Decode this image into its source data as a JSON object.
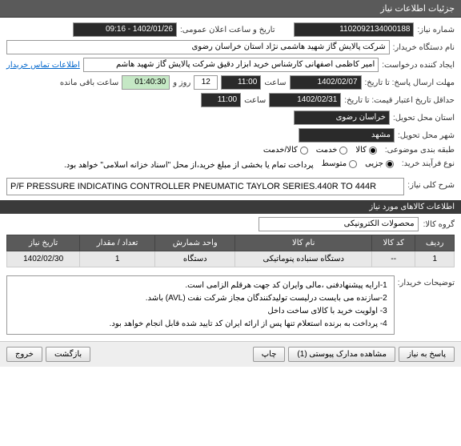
{
  "header": {
    "title": "جزئیات اطلاعات نیاز"
  },
  "fields": {
    "need_number_label": "شماره نیاز:",
    "need_number": "1102092134000188",
    "announce_label": "تاریخ و ساعت اعلان عمومی:",
    "announce_value": "1402/01/26 - 09:16",
    "buyer_label": "نام دستگاه خریدار:",
    "buyer_value": "شرکت پالایش گاز شهید هاشمی نژاد   استان خراسان رضوی",
    "creator_label": "ایجاد کننده درخواست:",
    "creator_value": "امیر کاظمی اصفهانی کارشناس خرید ابزار دقیق شرکت پالایش گاز شهید هاشم",
    "contact_link": "اطلاعات تماس خریدار",
    "deadline_label": "مهلت ارسال پاسخ: تا تاریخ:",
    "deadline_date": "1402/02/07",
    "deadline_hour_label": "ساعت",
    "deadline_hour": "11:00",
    "deadline_min": "12",
    "day_label": "روز و",
    "countdown": "01:40:30",
    "remaining": "ساعت باقی مانده",
    "price_valid_label": "حداقل تاریخ اعتبار قیمت: تا تاریخ:",
    "price_valid_date": "1402/02/31",
    "price_valid_hour": "11:00",
    "province_label": "استان محل تحویل:",
    "province_value": "خراسان رضوی",
    "city_label": "شهر محل تحویل:",
    "city_value": "مشهد",
    "classification_label": "طبقه بندی موضوعی:",
    "class_options": {
      "goods": "کالا",
      "service": "خدمت",
      "both": "کالا/خدمت"
    },
    "process_label": "نوع فرآیند خرید:",
    "process_options": {
      "minor": "جزیی",
      "medium": "متوسط"
    },
    "purchase_note": "پرداخت تمام یا بخشی از مبلغ خرید،از محل \"اسناد خزانه اسلامی\" خواهد بود."
  },
  "description": {
    "label": "شرح کلی نیاز:",
    "value": "P/F PRESSURE INDICATING CONTROLLER PNEUMATIC TAYLOR SERIES.440R TO 444R"
  },
  "subheader": {
    "title": "اطلاعات کالاهای مورد نیاز"
  },
  "group": {
    "label": "گروه کالا:",
    "value": "محصولات الکترونیکی"
  },
  "table": {
    "headers": {
      "row": "ردیف",
      "code": "کد کالا",
      "name": "نام کالا",
      "unit": "واحد شمارش",
      "qty": "تعداد / مقدار",
      "date": "تاریخ نیاز"
    },
    "rows": [
      {
        "row": "1",
        "code": "--",
        "name": "دستگاه سنباده پنوماتیکی",
        "unit": "دستگاه",
        "qty": "1",
        "date": "1402/02/30"
      }
    ]
  },
  "notes": {
    "label": "توضیحات خریدار:",
    "lines": [
      "1-ارایه پیشنهادفنی ،مالی وایران کد جهت هرقلم الزامی است.",
      "2-سازنده می بایست درلیست تولیدکنندگان مجاز شرکت نفت (AVL)  باشد.",
      "3- اولویت خرید با کالای ساخت داخل",
      "4- پرداخت به برنده استعلام تنها پس از ارائه ایران کد تایید شده قابل انجام خواهد بود."
    ]
  },
  "footer": {
    "respond": "پاسخ به نیاز",
    "attachments": "مشاهده مدارک پیوستی (1)",
    "print": "چاپ",
    "back": "بازگشت",
    "exit": "خروج"
  }
}
